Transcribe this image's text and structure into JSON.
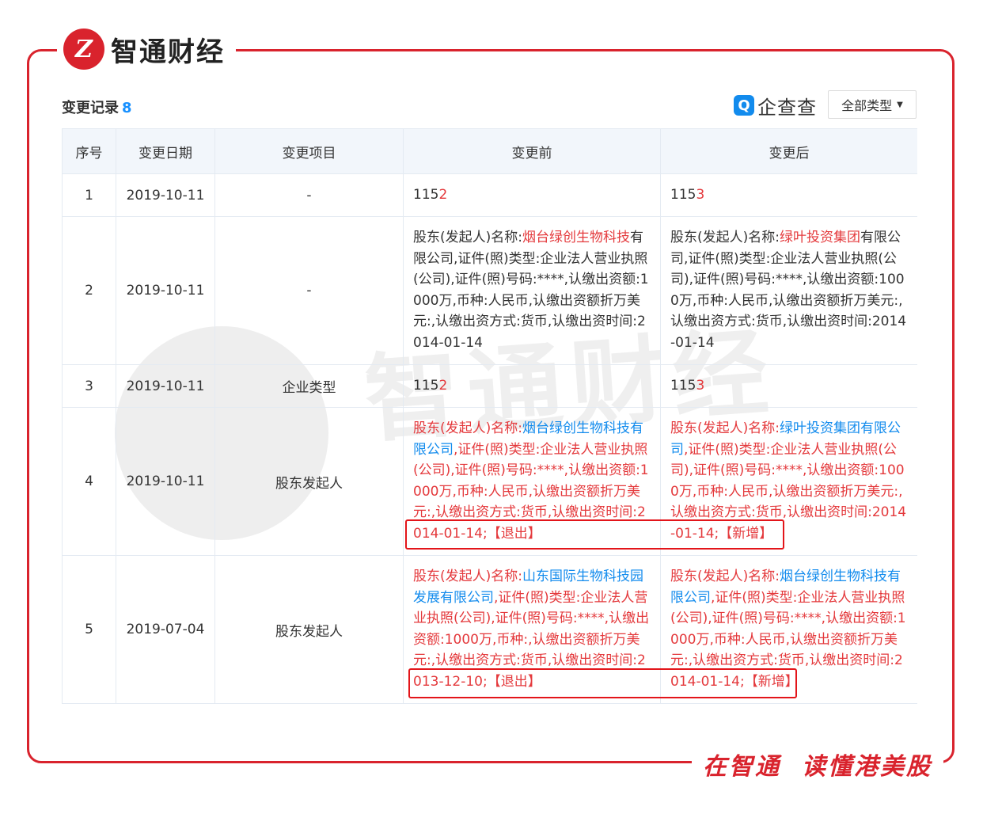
{
  "brand": {
    "logo_char": "Z",
    "name": "智通财经"
  },
  "slogan": {
    "part1": "在智通",
    "part2": "读懂港美股"
  },
  "header": {
    "title": "变更记录",
    "count": "8",
    "qcc_icon": "Q",
    "qcc_name": "企查查",
    "filter_label": "全部类型"
  },
  "columns": [
    "序号",
    "变更日期",
    "变更项目",
    "变更前",
    "变更后"
  ],
  "rows": [
    {
      "index": "1",
      "date": "2019-10-11",
      "item": "-",
      "before": [
        {
          "t": "115",
          "c": "n"
        },
        {
          "t": "2",
          "c": "r"
        }
      ],
      "after": [
        {
          "t": "115",
          "c": "n"
        },
        {
          "t": "3",
          "c": "r"
        }
      ]
    },
    {
      "index": "2",
      "date": "2019-10-11",
      "item": "-",
      "before": [
        {
          "t": "股东(发起人)名称:",
          "c": "n"
        },
        {
          "t": "烟台绿创生物科技",
          "c": "r"
        },
        {
          "t": "有限公司,证件(照)类型:企业法人营业执照(公司),证件(照)号码:****,认缴出资额:1000万,币种:人民币,认缴出资额折万美元:,认缴出资方式:货币,认缴出资时间:2014-01-14",
          "c": "n"
        }
      ],
      "after": [
        {
          "t": "股东(发起人)名称:",
          "c": "n"
        },
        {
          "t": "绿叶投资集团",
          "c": "r"
        },
        {
          "t": "有限公司,证件(照)类型:企业法人营业执照(公司),证件(照)号码:****,认缴出资额:1000万,币种:人民币,认缴出资额折万美元:,认缴出资方式:货币,认缴出资时间:2014-01-14",
          "c": "n"
        }
      ]
    },
    {
      "index": "3",
      "date": "2019-10-11",
      "item": "企业类型",
      "before": [
        {
          "t": "115",
          "c": "n"
        },
        {
          "t": "2",
          "c": "r"
        }
      ],
      "after": [
        {
          "t": "115",
          "c": "n"
        },
        {
          "t": "3",
          "c": "r"
        }
      ]
    },
    {
      "index": "4",
      "date": "2019-10-11",
      "item": "股东发起人",
      "before": [
        {
          "t": "股东(发起人)名称:",
          "c": "r"
        },
        {
          "t": "烟台绿创生物科技有限公司",
          "c": "b"
        },
        {
          "t": ",证件(照)类型:企业法人营业执照(公司),证件(照)号码:****,认缴出资额:1000万,币种:人民币,认缴出资额折万美元:,认缴出资方式:货币,认缴出资时间:2014-01-14;【退出】",
          "c": "r"
        }
      ],
      "after": [
        {
          "t": "股东(发起人)名称:",
          "c": "r"
        },
        {
          "t": "绿叶投资集团有限公司",
          "c": "b"
        },
        {
          "t": ",证件(照)类型:企业法人营业执照(公司),证件(照)号码:****,认缴出资额:1000万,币种:人民币,认缴出资额折万美元:,认缴出资方式:货币,认缴出资时间:2014-01-14;【新增】",
          "c": "r"
        }
      ]
    },
    {
      "index": "5",
      "date": "2019-07-04",
      "item": "股东发起人",
      "before": [
        {
          "t": "股东(发起人)名称:",
          "c": "r"
        },
        {
          "t": "山东国际生物科技园发展有限公司",
          "c": "b"
        },
        {
          "t": ",证件(照)类型:企业法人营业执照(公司),证件(照)号码:****,认缴出资额:1000万,币种:,认缴出资额折万美元:,认缴出资方式:货币,认缴出资时间:2013-12-10;【退出】",
          "c": "r"
        }
      ],
      "after": [
        {
          "t": "股东(发起人)名称:",
          "c": "r"
        },
        {
          "t": "烟台绿创生物科技有限公司",
          "c": "b"
        },
        {
          "t": ",证件(照)类型:企业法人营业执照(公司),证件(照)号码:****,认缴出资额:1000万,币种:人民币,认缴出资额折万美元:,认缴出资方式:货币,认缴出资时间:2014-01-14;【新增】",
          "c": "r"
        }
      ]
    }
  ],
  "watermark_text": "智通财经",
  "colors": {
    "brand_red": "#d9232d",
    "link_blue": "#128bed",
    "change_red": "#e4393c",
    "header_bg": "#f2f6fb"
  }
}
